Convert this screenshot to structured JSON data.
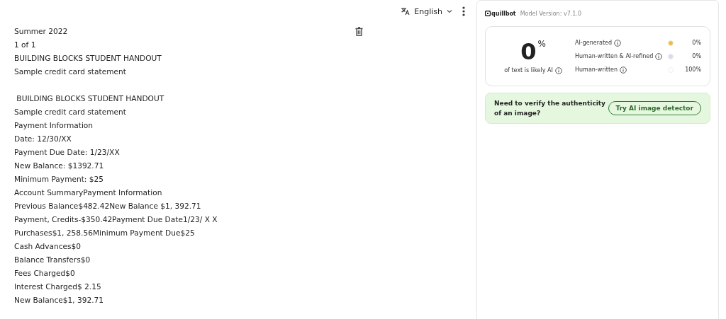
{
  "toolbar": {
    "language": "English"
  },
  "document": {
    "paragraphs": [
      [
        "Summer 2022",
        "1 of 1",
        "BUILDING BLOCKS STUDENT HANDOUT",
        "Sample credit card statement"
      ],
      [
        " BUILDING BLOCKS STUDENT HANDOUT",
        "Sample credit card statement",
        "Payment Information",
        "Date: 12/30/XX",
        "Payment Due Date: 1/23/XX",
        "New Balance: $1392.71",
        "Minimum Payment: $25",
        "Account SummaryPayment Information",
        "Previous Balance$482.42New Balance $1, 392.71",
        "Payment, Credits-$350.42Payment Due Date1/23/ X X",
        "Purchases$1, 258.56Minimum Payment Due$25",
        "Cash Advances$0",
        "Balance Transfers$0",
        "Fees Charged$0",
        "Interest Charged$ 2.15",
        "New Balance$1, 392.71"
      ]
    ]
  },
  "panel": {
    "brand": "quillbot",
    "model_version": "Model Version: v7.1.0",
    "score": {
      "value": "0",
      "unit": "%",
      "caption": "of text is likely AI"
    },
    "breakdown": [
      {
        "label": "AI-generated",
        "color": "#f5b942",
        "percent": "0%"
      },
      {
        "label": "Human-written & AI-refined",
        "color": "#d6dcf0",
        "percent": "0%"
      },
      {
        "label": "Human-written",
        "color": "#ffffff",
        "percent": "100%"
      }
    ],
    "promo": {
      "text": "Need to verify the authenticity of an image?",
      "button": "Try AI image detector"
    }
  }
}
